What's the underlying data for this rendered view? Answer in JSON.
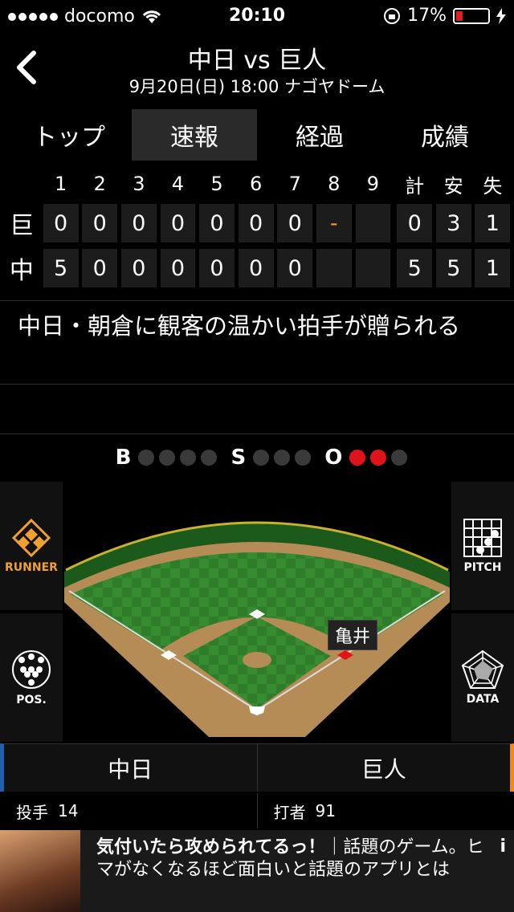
{
  "status_bar": {
    "carrier": "docomo",
    "time": "20:10",
    "battery": "17%"
  },
  "header": {
    "title": "中日 vs 巨人",
    "subtitle": "9月20日(日) 18:00 ナゴヤドーム"
  },
  "tabs": [
    {
      "label": "トップ"
    },
    {
      "label": "速報"
    },
    {
      "label": "経過"
    },
    {
      "label": "成績"
    }
  ],
  "scoreboard": {
    "headers": [
      "1",
      "2",
      "3",
      "4",
      "5",
      "6",
      "7",
      "8",
      "9",
      "計",
      "安",
      "失"
    ],
    "rows": [
      {
        "team": "巨",
        "cells": [
          "0",
          "0",
          "0",
          "0",
          "0",
          "0",
          "0",
          "-",
          "",
          "0",
          "3",
          "1"
        ]
      },
      {
        "team": "中",
        "cells": [
          "5",
          "0",
          "0",
          "0",
          "0",
          "0",
          "0",
          "",
          "",
          "5",
          "5",
          "1"
        ]
      }
    ]
  },
  "news": "中日・朝倉に観客の温かい拍手が贈られる",
  "bso": {
    "b_label": "B",
    "s_label": "S",
    "o_label": "O",
    "balls": 0,
    "strikes": 0,
    "outs": 2
  },
  "side_buttons": {
    "runner": "RUNNER",
    "pos": "POS.",
    "pitch": "PITCH",
    "data": "DATA"
  },
  "field": {
    "player_tag": "亀井"
  },
  "teams": {
    "left": "中日",
    "right": "巨人"
  },
  "players": {
    "left_role": "投手",
    "left_num": "14",
    "right_role": "打者",
    "right_num": "91"
  },
  "ad": {
    "headline": "気付いたら攻められてるっ！",
    "text": "｜話題のゲーム。ヒマがなくなるほど面白いと話題のアプリとは",
    "info": "i"
  },
  "colors": {
    "orange": "#f0a030",
    "red": "#e0131b",
    "team_left": "#1e5fb0",
    "team_right": "#f08a1a"
  }
}
